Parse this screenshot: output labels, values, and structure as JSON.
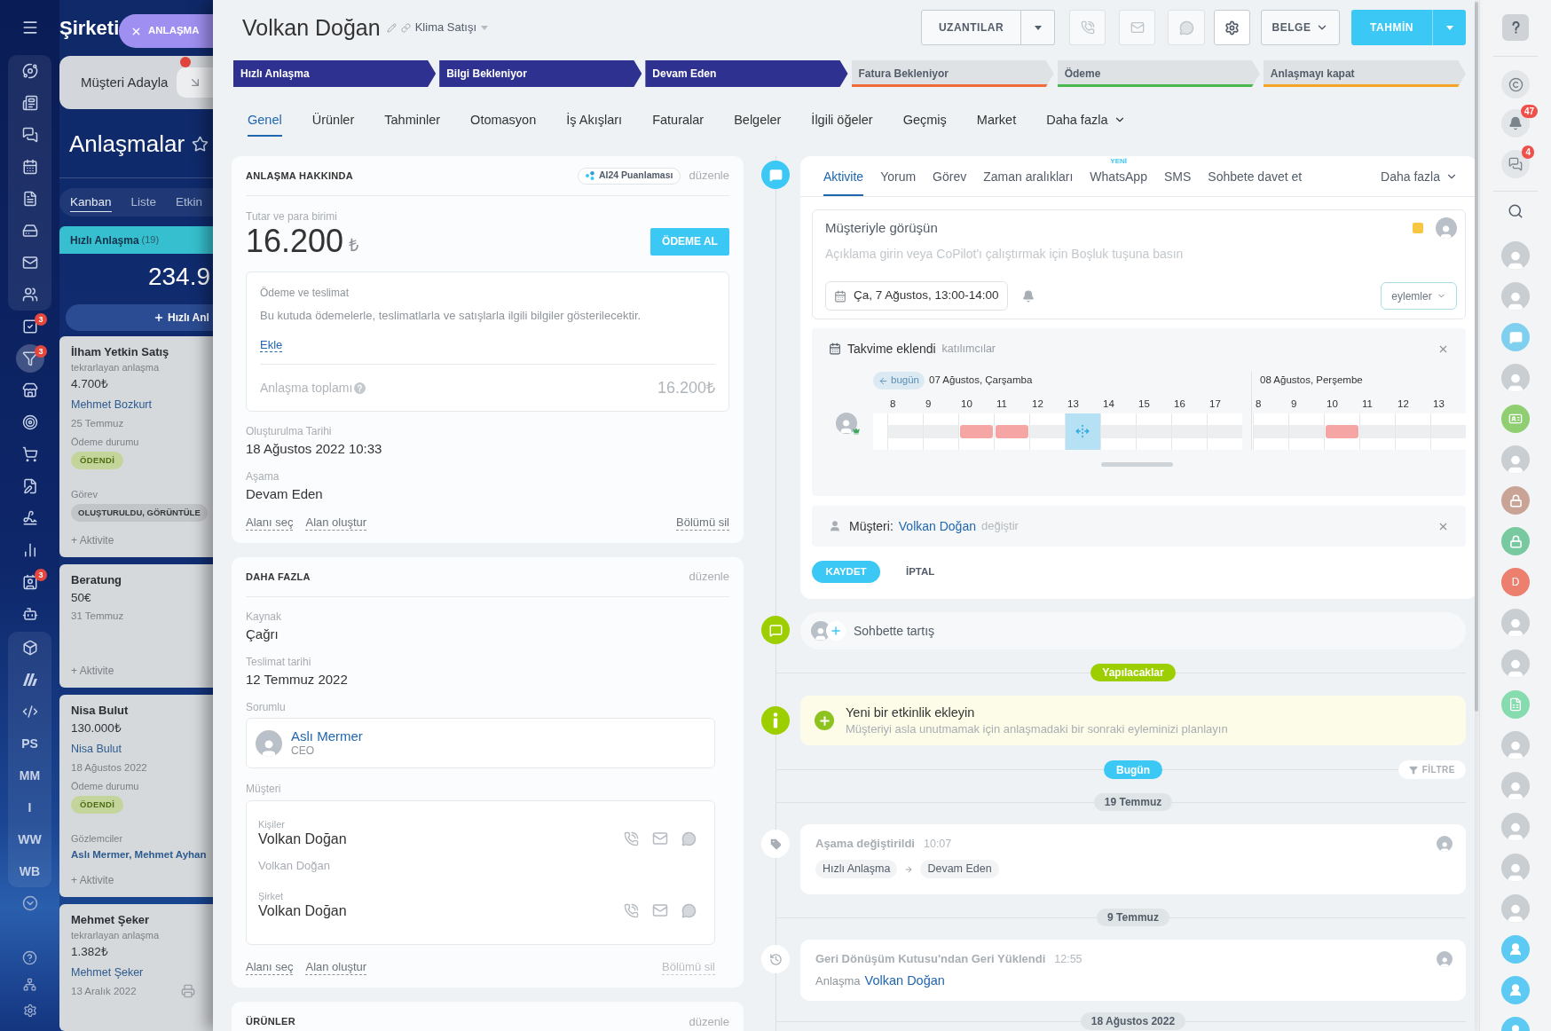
{
  "left_nav": {
    "items": [
      {
        "selected": false
      },
      {
        "selected": false
      },
      {
        "selected": false
      },
      {
        "selected": false
      },
      {
        "selected": false
      },
      {
        "selected": false
      },
      {
        "selected": false
      },
      {
        "selected": false
      },
      {
        "selected": false,
        "badge": "3"
      },
      {
        "selected": true,
        "badge": "3"
      },
      {
        "selected": false
      },
      {
        "selected": false
      },
      {
        "selected": false
      },
      {
        "selected": false
      },
      {
        "selected": false
      },
      {
        "selected": false
      },
      {
        "selected": false,
        "badge": "3"
      },
      {
        "selected": false
      },
      {
        "selected": false
      },
      {
        "selected": false
      },
      {
        "selected": false
      }
    ],
    "apps": [
      {
        "label": "PS",
        "selected": false
      },
      {
        "label": "MM",
        "selected": false
      },
      {
        "label": "I",
        "selected": false
      },
      {
        "label": "WW",
        "selected": false
      },
      {
        "label": "WB",
        "selected": false
      }
    ]
  },
  "kanban": {
    "company": "Şirketi",
    "close_tab": "ANLAŞMA",
    "leads_button": "Müşteri Adayla",
    "title": "Anlaşmalar",
    "views": [
      {
        "label": "Kanban",
        "selected": true
      },
      {
        "label": "Liste",
        "selected": false
      },
      {
        "label": "Etkin",
        "selected": false
      }
    ],
    "column": {
      "title": "Hızlı Anlaşma",
      "count": "(19)",
      "total": "234.9",
      "add_button": "Hızlı Anl"
    },
    "cards": [
      {
        "title": "İlham Yetkin Satış",
        "subtitle": "tekrarlayan anlaşma",
        "amount": "4.700₺",
        "contact": "Mehmet Bozkurt",
        "date": "25 Temmuz",
        "fields": [
          {
            "label": "Ödeme durumu",
            "value": "ÖDENDİ",
            "kind": "paid"
          },
          {
            "label": "Görev",
            "value": "OLUŞTURULDU, GÖRÜNTÜLE",
            "kind": "status"
          }
        ],
        "activity": "+ Aktivite",
        "printable": false
      },
      {
        "title": "Beratung",
        "amount": "50€",
        "date": "31 Temmuz",
        "activity": "+ Aktivite",
        "printable": false
      },
      {
        "title": "Nisa Bulut",
        "amount": "130.000₺",
        "contact": "Nisa Bulut",
        "date": "18 Ağustos 2022",
        "fields": [
          {
            "label": "Ödeme durumu",
            "value": "ÖDENDİ",
            "kind": "paid"
          },
          {
            "label": "Gözlemciler",
            "value": "Aslı Mermer, Mehmet Ayhan",
            "kind": "people"
          }
        ],
        "activity": "+ Aktivite",
        "printable": false
      },
      {
        "title": "Mehmet Şeker",
        "subtitle": "tekrarlayan anlaşma",
        "amount": "1.382₺",
        "contact": "Mehmet Şeker",
        "date": "13 Aralık 2022",
        "printable": true
      }
    ]
  },
  "deal": {
    "title": "Volkan Doğan",
    "category": "Klima Satışı",
    "toolbar": {
      "extensions": "UZANTILAR",
      "document": "BELGE",
      "estimate": "TAHMİN"
    },
    "stages": [
      {
        "label": "Hızlı Anlaşma",
        "active": true,
        "color": "#2f3190"
      },
      {
        "label": "Bilgi Bekleniyor",
        "active": true,
        "color": "#2f3190"
      },
      {
        "label": "Devam Eden",
        "active": true,
        "color": "#2f3190"
      },
      {
        "label": "Fatura Bekleniyor",
        "active": false,
        "color": "#ef6b3a"
      },
      {
        "label": "Ödeme",
        "active": false,
        "color": "#48b84f"
      },
      {
        "label": "Anlaşmayı kapat",
        "active": false,
        "color": "#f5a425"
      }
    ],
    "tabs": [
      {
        "label": "Genel",
        "selected": true
      },
      {
        "label": "Ürünler",
        "selected": false
      },
      {
        "label": "Tahminler",
        "selected": false
      },
      {
        "label": "Otomasyon",
        "selected": false
      },
      {
        "label": "İş Akışları",
        "selected": false
      },
      {
        "label": "Faturalar",
        "selected": false
      },
      {
        "label": "Belgeler",
        "selected": false
      },
      {
        "label": "İlgili öğeler",
        "selected": false
      },
      {
        "label": "Geçmiş",
        "selected": false
      },
      {
        "label": "Market",
        "selected": false
      }
    ],
    "tabs_more": "Daha fazla",
    "about": {
      "title": "ANLAŞMA HAKKINDA",
      "ai_score": "AI24 Puanlaması",
      "edit": "düzenle",
      "amount_label": "Tutar ve para birimi",
      "amount": "16.200",
      "currency": "₺",
      "pay_button": "ÖDEME AL",
      "payment": {
        "title": "Ödeme ve teslimat",
        "text": "Bu kutuda ödemelerle, teslimatlarla ve satışlarla ilgili bilgiler gösterilecektir.",
        "add": "Ekle",
        "total_label": "Anlaşma toplamı",
        "total": "16.200₺"
      },
      "fields": [
        {
          "label": "Oluşturulma Tarihi",
          "value": "18 Ağustos 2022 10:33"
        },
        {
          "label": "Aşama",
          "value": "Devam Eden"
        }
      ],
      "links": [
        "Alanı seç",
        "Alan oluştur"
      ],
      "delete": {
        "label": "Bölümü sil",
        "disabled": false
      }
    },
    "more": {
      "title": "DAHA FAZLA",
      "edit": "düzenle",
      "fields": [
        {
          "label": "Kaynak",
          "value": "Çağrı"
        },
        {
          "label": "Teslimat tarihi",
          "value": "12 Temmuz 2022"
        }
      ],
      "responsible": {
        "label": "Sorumlu",
        "name": "Aslı Mermer",
        "role": "CEO"
      },
      "client": {
        "label": "Müşteri",
        "contacts_label": "Kişiler",
        "contact": "Volkan Doğan",
        "contact_detail": "Volkan Doğan",
        "company_label": "Şirket",
        "company": "Volkan Doğan"
      },
      "links": [
        "Alanı seç",
        "Alan oluştur"
      ],
      "delete": {
        "label": "Bölümü sil",
        "disabled": true
      }
    },
    "products": {
      "title": "ÜRÜNLER",
      "edit": "düzenle"
    }
  },
  "activity": {
    "tabs": [
      {
        "label": "Aktivite",
        "selected": true
      },
      {
        "label": "Yorum",
        "selected": false
      },
      {
        "label": "Görev",
        "selected": false
      },
      {
        "label": "Zaman aralıkları",
        "selected": false
      },
      {
        "label": "WhatsApp",
        "selected": false,
        "tag": "YENİ"
      },
      {
        "label": "SMS",
        "selected": false
      },
      {
        "label": "Sohbete davet et",
        "selected": false
      }
    ],
    "more": "Daha fazla",
    "subject": "Müşteriyle görüşün",
    "placeholder": "Açıklama girin veya CoPilot'ı çalıştırmak için Boşluk tuşuna basın",
    "date": "Ça, 7 Ağustos, 13:00-14:00",
    "actions": "eylemler",
    "calendar": {
      "title": "Takvime eklendi",
      "participants": "katılımcılar",
      "today": "bugün",
      "days": [
        {
          "label": "07 Ağustos, Çarşamba",
          "hours": [
            {
              "label": "8",
              "busy": false,
              "selected": false
            },
            {
              "label": "9",
              "busy": false,
              "selected": false
            },
            {
              "label": "10",
              "busy": true,
              "selected": false
            },
            {
              "label": "11",
              "busy": true,
              "selected": false
            },
            {
              "label": "12",
              "busy": false,
              "selected": false
            },
            {
              "label": "13",
              "busy": false,
              "selected": true
            },
            {
              "label": "14",
              "busy": false,
              "selected": false
            },
            {
              "label": "15",
              "busy": false,
              "selected": false
            },
            {
              "label": "16",
              "busy": false,
              "selected": false
            },
            {
              "label": "17",
              "busy": false,
              "selected": false
            }
          ]
        },
        {
          "label": "08 Ağustos, Perşembe",
          "hours": [
            {
              "label": "8",
              "busy": false,
              "selected": false
            },
            {
              "label": "9",
              "busy": false,
              "selected": false
            },
            {
              "label": "10",
              "busy": true,
              "selected": false
            },
            {
              "label": "11",
              "busy": false,
              "selected": false
            },
            {
              "label": "12",
              "busy": false,
              "selected": false
            },
            {
              "label": "13",
              "busy": false,
              "selected": false
            }
          ]
        }
      ]
    },
    "client": {
      "label": "Müşteri:",
      "name": "Volkan Doğan",
      "change": "değiştir"
    },
    "save": "KAYDET",
    "cancel": "İPTAL"
  },
  "timeline": {
    "chat": "Sohbette tartış",
    "todo": "Yapılacaklar",
    "add_activity": {
      "title": "Yeni bir etkinlik ekleyin",
      "text": "Müşteriyi asla unutmamak için anlaşmadaki bir sonraki eyleminizi planlayın"
    },
    "today": "Bugün",
    "filter": "FİLTRE",
    "history": [
      {
        "date": "19 Temmuz",
        "events": [
          {
            "kind": "stage",
            "title": "Aşama değiştirildi",
            "time": "10:07",
            "from": "Hızlı Anlaşma",
            "to": "Devam Eden"
          }
        ]
      },
      {
        "date": "9 Temmuz",
        "events": [
          {
            "kind": "restore",
            "title": "Geri Dönüşüm Kutusu'ndan Geri Yüklendi",
            "time": "12:55",
            "text": "Anlaşma",
            "link": "Volkan Doğan"
          }
        ]
      },
      {
        "date": "18 Ağustos 2022"
      }
    ]
  },
  "right_sidebar": {
    "notifications": "47",
    "messages": "4",
    "contacts": [
      {
        "kind": "avatar"
      },
      {
        "kind": "avatar"
      },
      {
        "kind": "chat"
      },
      {
        "kind": "avatar"
      },
      {
        "kind": "contact-card"
      },
      {
        "kind": "avatar"
      },
      {
        "kind": "lock",
        "color": "#c9a396"
      },
      {
        "kind": "lock",
        "color": "#79c9a0"
      },
      {
        "kind": "letter",
        "letter": "D",
        "color": "#ec7f6d"
      },
      {
        "kind": "avatar"
      },
      {
        "kind": "avatar"
      },
      {
        "kind": "document"
      },
      {
        "kind": "avatar"
      },
      {
        "kind": "avatar"
      },
      {
        "kind": "avatar"
      },
      {
        "kind": "avatar"
      },
      {
        "kind": "avatar"
      },
      {
        "kind": "schedule"
      },
      {
        "kind": "schedule"
      },
      {
        "kind": "schedule"
      }
    ]
  }
}
